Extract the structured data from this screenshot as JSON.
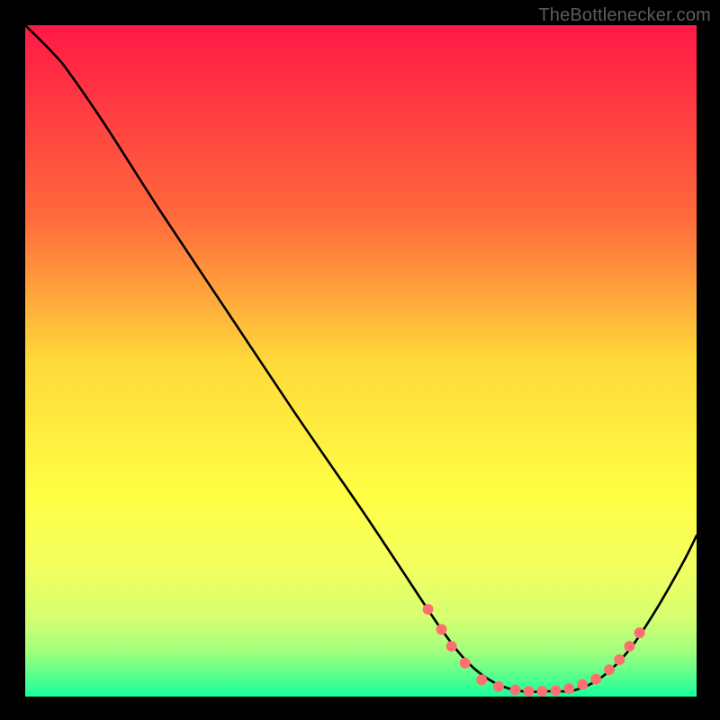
{
  "watermark": "TheBottlenecker.com",
  "chart_data": {
    "type": "line",
    "title": "",
    "xlabel": "",
    "ylabel": "",
    "xlim": [
      0,
      100
    ],
    "ylim": [
      0,
      100
    ],
    "grid": false,
    "legend": false,
    "background_gradient_stops": [
      {
        "offset": 0.0,
        "color": "#ff1846"
      },
      {
        "offset": 0.29,
        "color": "#ff6b3c"
      },
      {
        "offset": 0.5,
        "color": "#ffd93a"
      },
      {
        "offset": 0.7,
        "color": "#ffff44"
      },
      {
        "offset": 0.8,
        "color": "#f4ff5e"
      },
      {
        "offset": 0.88,
        "color": "#d7ff70"
      },
      {
        "offset": 0.93,
        "color": "#a6ff7c"
      },
      {
        "offset": 0.97,
        "color": "#56ff8d"
      },
      {
        "offset": 1.0,
        "color": "#17ff9c"
      }
    ],
    "curve": [
      {
        "x": 0.0,
        "y": 100.0
      },
      {
        "x": 4.0,
        "y": 96.0
      },
      {
        "x": 6.5,
        "y": 93.0
      },
      {
        "x": 12.0,
        "y": 85.0
      },
      {
        "x": 20.0,
        "y": 72.5
      },
      {
        "x": 30.0,
        "y": 57.5
      },
      {
        "x": 40.0,
        "y": 42.5
      },
      {
        "x": 50.0,
        "y": 28.0
      },
      {
        "x": 56.0,
        "y": 19.0
      },
      {
        "x": 62.0,
        "y": 10.0
      },
      {
        "x": 66.0,
        "y": 5.0
      },
      {
        "x": 70.0,
        "y": 2.0
      },
      {
        "x": 74.0,
        "y": 0.8
      },
      {
        "x": 78.0,
        "y": 0.8
      },
      {
        "x": 82.0,
        "y": 1.0
      },
      {
        "x": 86.0,
        "y": 3.0
      },
      {
        "x": 90.0,
        "y": 7.0
      },
      {
        "x": 94.0,
        "y": 13.0
      },
      {
        "x": 98.0,
        "y": 20.0
      },
      {
        "x": 100.0,
        "y": 24.0
      }
    ],
    "markers": [
      {
        "x": 60.0,
        "y": 13.0
      },
      {
        "x": 62.0,
        "y": 10.0
      },
      {
        "x": 63.5,
        "y": 7.5
      },
      {
        "x": 65.5,
        "y": 5.0
      },
      {
        "x": 68.0,
        "y": 2.5
      },
      {
        "x": 70.5,
        "y": 1.5
      },
      {
        "x": 73.0,
        "y": 1.0
      },
      {
        "x": 75.0,
        "y": 0.8
      },
      {
        "x": 77.0,
        "y": 0.8
      },
      {
        "x": 79.0,
        "y": 0.9
      },
      {
        "x": 81.0,
        "y": 1.2
      },
      {
        "x": 83.0,
        "y": 1.8
      },
      {
        "x": 85.0,
        "y": 2.6
      },
      {
        "x": 87.0,
        "y": 4.0
      },
      {
        "x": 88.5,
        "y": 5.5
      },
      {
        "x": 90.0,
        "y": 7.5
      },
      {
        "x": 91.5,
        "y": 9.5
      }
    ],
    "marker_style": {
      "color": "#ff6f6f",
      "radius_px": 6
    }
  }
}
